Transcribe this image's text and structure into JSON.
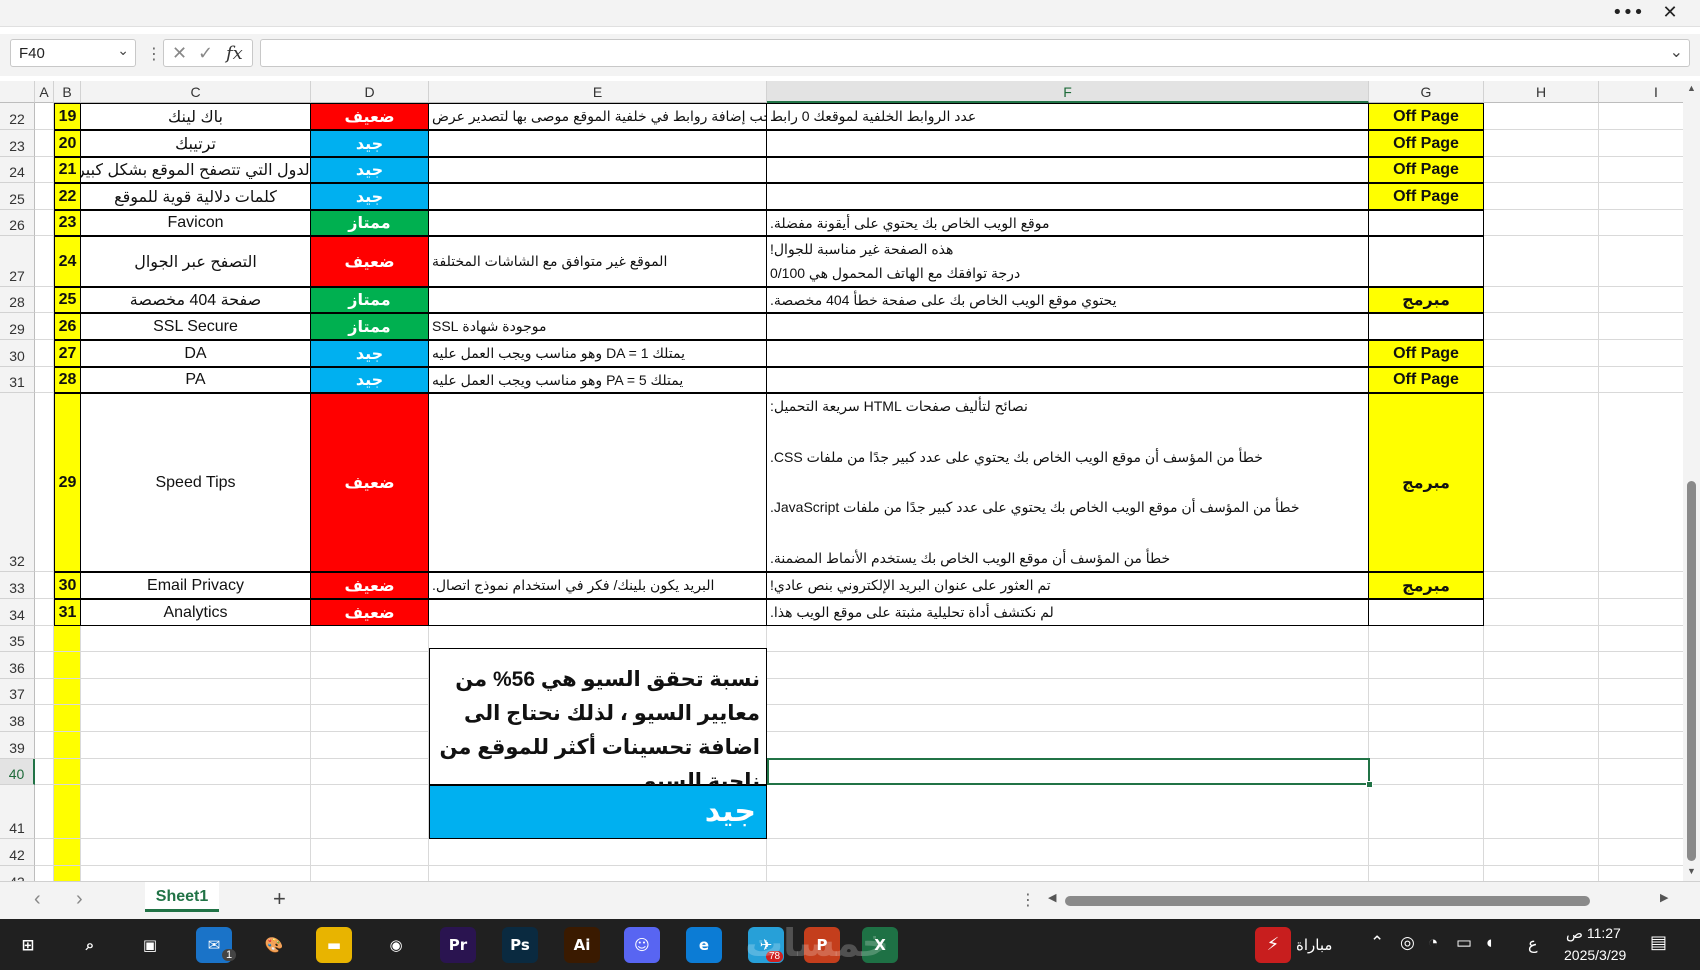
{
  "window": {
    "more_icon": "ellipsis-icon",
    "close_icon": "close-icon",
    "more_label": "•••",
    "close_label": "✕"
  },
  "formula_bar": {
    "name_box": "F40",
    "fx_label": "fx",
    "cancel_glyph": "✕",
    "enter_glyph": "✓",
    "formula": ""
  },
  "columns": [
    "A",
    "B",
    "C",
    "D",
    "E",
    "F",
    "G",
    "H",
    "I"
  ],
  "rows": [
    {
      "num": "22",
      "b": "19",
      "c": "باك لينك",
      "d": "ضعيف",
      "d_class": "red",
      "e": "يجب إضافة روابط في خلفية الموقع موصى بها لتصدير عرض",
      "f": "عدد الروابط الخلفية لموقعك 0 رابط",
      "g": "Off Page"
    },
    {
      "num": "23",
      "b": "20",
      "c": "ترتيبك",
      "d": "جيد",
      "d_class": "blue",
      "e": "",
      "f": "",
      "g": "Off Page"
    },
    {
      "num": "24",
      "b": "21",
      "c": "الدول التي تتصفح الموقع بشكل كبير",
      "d": "جيد",
      "d_class": "blue",
      "e": "",
      "f": "",
      "g": "Off Page"
    },
    {
      "num": "25",
      "b": "22",
      "c": "كلمات دلالية قوية للموقع",
      "d": "جيد",
      "d_class": "blue",
      "e": "",
      "f": "",
      "g": "Off Page"
    },
    {
      "num": "26",
      "b": "23",
      "c": "Favicon",
      "d": "ممتاز",
      "d_class": "green",
      "e": "",
      "f": "موقع الويب الخاص بك  يحتوي على أيقونة مفضلة.",
      "g": ""
    },
    {
      "num": "27",
      "b": "24",
      "c": "التصفح عبر الجوال",
      "d": "ضعيف",
      "d_class": "red",
      "e": "الموقع غير متوافق مع الشاشات المختلفة",
      "f": "هذه الصفحة غير مناسبة للجوال!",
      "f2": "درجة توافقك مع الهاتف المحمول هي 0/100",
      "g": ""
    },
    {
      "num": "28",
      "b": "25",
      "c": "صفحة 404 مخصصة",
      "d": "ممتاز",
      "d_class": "green",
      "e": "",
      "f": "يحتوي موقع الويب الخاص بك على صفحة خطأ 404 مخصصة.",
      "g": "مبرمج"
    },
    {
      "num": "29",
      "b": "26",
      "c": "SSL Secure",
      "d": "ممتاز",
      "d_class": "green",
      "e": "موجودة شهادة SSL",
      "f": "",
      "g": ""
    },
    {
      "num": "30",
      "b": "27",
      "c": "DA",
      "d": "جيد",
      "d_class": "blue",
      "e": "يمتلك DA = 1 وهو مناسب ويجب العمل عليه",
      "f": "",
      "g": "Off Page"
    },
    {
      "num": "31",
      "b": "28",
      "c": "PA",
      "d": "جيد",
      "d_class": "blue",
      "e": "يمتلك PA = 5 وهو مناسب ويجب العمل عليه",
      "f": "",
      "g": "Off Page"
    },
    {
      "num": "32",
      "b": "29",
      "c": "Speed Tips",
      "d": "ضعيف",
      "d_class": "red",
      "e": "",
      "f_lines": [
        "نصائح لتأليف صفحات HTML سريعة التحميل:",
        "خطأ من المؤسف أن موقع الويب الخاص بك يحتوي على عدد كبير جدًا من ملفات CSS.",
        "خطأ من المؤسف أن موقع الويب الخاص بك يحتوي على عدد كبير جدًا من ملفات JavaScript.",
        "خطأ من المؤسف أن موقع الويب الخاص بك يستخدم الأنماط المضمنة."
      ],
      "g": "مبرمج"
    },
    {
      "num": "33",
      "b": "30",
      "c": "Email Privacy",
      "d": "ضعيف",
      "d_class": "red",
      "e": "البريد يكون بلينك/ فكر في استخدام نموذج اتصال.",
      "f": "تم العثور على عنوان البريد الإلكتروني بنص عادي!",
      "g": "مبرمج"
    },
    {
      "num": "34",
      "b": "31",
      "c": "Analytics",
      "d": "ضعيف",
      "d_class": "red",
      "e": "",
      "f": "لم نكتشف أداة تحليلية مثبتة على موقع الويب هذا.",
      "g": ""
    }
  ],
  "empty_rows": [
    "35",
    "36",
    "37",
    "38",
    "39",
    "40",
    "41",
    "42",
    "43"
  ],
  "summary_box": {
    "text": "نسبة تحقق السيو هي 56% من معايير السيو ، لذلك نحتاج الى اضافة تحسينات أكثر للموقع من ناحية السيو",
    "rating": "جيد"
  },
  "sheets": {
    "active": "Sheet1",
    "add_glyph": "+",
    "prev_glyph": "‹",
    "next_glyph": "›"
  },
  "taskbar": {
    "apps": [
      {
        "name": "start",
        "label": "⊞",
        "color": "#202020"
      },
      {
        "name": "search",
        "label": "⌕",
        "color": "#202020"
      },
      {
        "name": "task-view",
        "label": "▣",
        "color": "#202020"
      },
      {
        "name": "mail",
        "label": "✉",
        "color": "#1a73c8"
      },
      {
        "name": "paint",
        "label": "🎨",
        "color": "#202020"
      },
      {
        "name": "file-explorer",
        "label": "▬",
        "color": "#e8b400"
      },
      {
        "name": "chrome",
        "label": "◉",
        "color": "#202020"
      },
      {
        "name": "premiere",
        "label": "Pr",
        "color": "#2a1450"
      },
      {
        "name": "photoshop",
        "label": "Ps",
        "color": "#0a2a40"
      },
      {
        "name": "illustrator",
        "label": "Ai",
        "color": "#3a1a00"
      },
      {
        "name": "discord",
        "label": "☺",
        "color": "#5865f2"
      },
      {
        "name": "edge",
        "label": "e",
        "color": "#0c7cd5"
      },
      {
        "name": "telegram",
        "label": "✈",
        "color": "#27a0d8"
      },
      {
        "name": "powerpoint",
        "label": "P",
        "color": "#c43e1c"
      },
      {
        "name": "excel",
        "label": "X",
        "color": "#1e7145"
      }
    ],
    "telegram_badge": "78",
    "mail_badge": "1",
    "widget_label": "مباراة",
    "lang": "ع",
    "time": "11:27 ص",
    "date": "2025/3/29",
    "watermark": "خمسات"
  }
}
